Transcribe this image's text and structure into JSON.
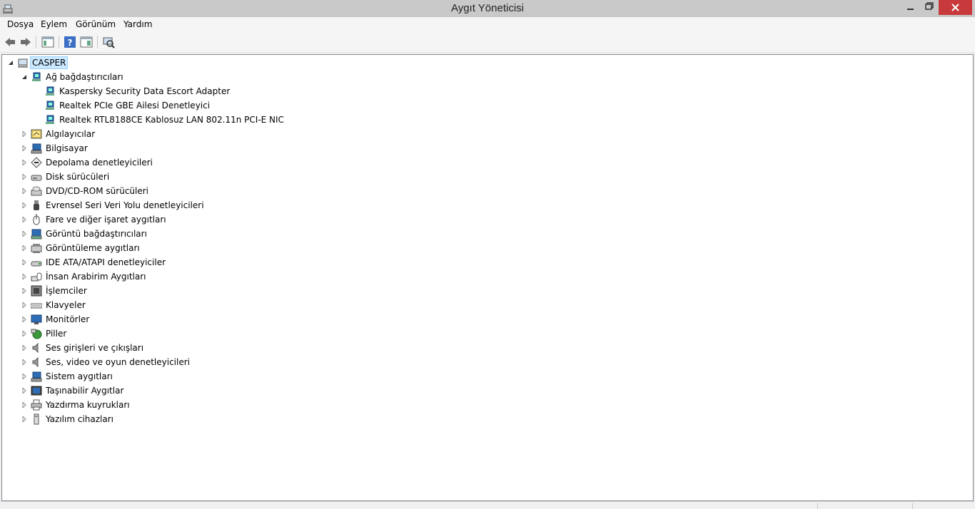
{
  "window": {
    "title": "Aygıt Yöneticisi",
    "close_color": "#c7393a"
  },
  "menu": [
    "Dosya",
    "Eylem",
    "Görünüm",
    "Yardım"
  ],
  "toolbar": {
    "buttons": [
      "back-arrow-icon",
      "forward-arrow-icon",
      "show-hide-console-tree-icon",
      "help-icon",
      "properties-icon",
      "scan-hardware-icon"
    ]
  },
  "tree": {
    "root": {
      "label": "CASPER",
      "icon": "computer-icon",
      "expanded": true
    },
    "categories": [
      {
        "label": "Ağ bağdaştırıcıları",
        "icon": "network-adapter-icon",
        "expanded": true,
        "children": [
          "Kaspersky Security Data Escort Adapter",
          "Realtek PCIe GBE Ailesi Denetleyici",
          "Realtek RTL8188CE Kablosuz LAN 802.11n PCI-E NIC"
        ]
      },
      {
        "label": "Algılayıcılar",
        "icon": "sensor-icon"
      },
      {
        "label": "Bilgisayar",
        "icon": "computer-icon"
      },
      {
        "label": "Depolama denetleyicileri",
        "icon": "storage-controller-icon"
      },
      {
        "label": "Disk sürücüleri",
        "icon": "disk-drive-icon"
      },
      {
        "label": "DVD/CD-ROM sürücüleri",
        "icon": "dvd-drive-icon"
      },
      {
        "label": "Evrensel Seri Veri Yolu denetleyicileri",
        "icon": "usb-icon"
      },
      {
        "label": "Fare ve diğer işaret aygıtları",
        "icon": "mouse-icon"
      },
      {
        "label": "Görüntü bağdaştırıcıları",
        "icon": "display-adapter-icon"
      },
      {
        "label": "Görüntüleme aygıtları",
        "icon": "imaging-device-icon"
      },
      {
        "label": "IDE ATA/ATAPI denetleyiciler",
        "icon": "ide-controller-icon"
      },
      {
        "label": "İnsan Arabirim Aygıtları",
        "icon": "hid-icon"
      },
      {
        "label": "İşlemciler",
        "icon": "processor-icon"
      },
      {
        "label": "Klavyeler",
        "icon": "keyboard-icon"
      },
      {
        "label": "Monitörler",
        "icon": "monitor-icon"
      },
      {
        "label": "Piller",
        "icon": "battery-icon"
      },
      {
        "label": "Ses girişleri ve çıkışları",
        "icon": "speaker-icon"
      },
      {
        "label": "Ses, video ve oyun denetleyicileri",
        "icon": "sound-controller-icon"
      },
      {
        "label": "Sistem aygıtları",
        "icon": "system-device-icon"
      },
      {
        "label": "Taşınabilir Aygıtlar",
        "icon": "portable-device-icon"
      },
      {
        "label": "Yazdırma kuyrukları",
        "icon": "printer-icon"
      },
      {
        "label": "Yazılım cihazları",
        "icon": "software-device-icon"
      }
    ]
  }
}
